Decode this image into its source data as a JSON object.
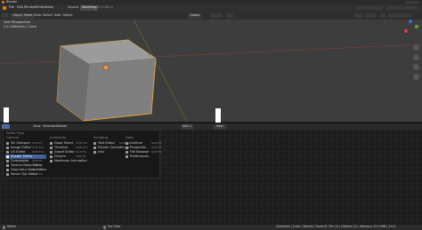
{
  "window": {
    "title": "Blender"
  },
  "menubar": {
    "items": [
      "File",
      "Edit",
      "Render",
      "Window",
      "Help"
    ],
    "tabs": [
      "Layout",
      "Modeling",
      "UV Editing"
    ],
    "active_tab_index": 1
  },
  "viewport": {
    "mode_label": "Object Mode",
    "header_items": [
      "View",
      "Select",
      "Add",
      "Object"
    ],
    "overlay_line1": "User Perspective",
    "overlay_line2": "(1) Collection | Cube",
    "transform_label": "Global"
  },
  "editor": {
    "header_items": [
      "View",
      "Select",
      "Add",
      "Node"
    ],
    "new_label": "New",
    "slot_label": "Slot 1"
  },
  "editor_type_menu": {
    "title": "Editor Type",
    "columns": [
      {
        "heading": "General",
        "items": [
          {
            "label": "3D Viewport",
            "shortcut": "Shift F5"
          },
          {
            "label": "Image Editor",
            "shortcut": "Shift F10"
          },
          {
            "label": "UV Editor",
            "shortcut": "Shift F10"
          },
          {
            "label": "Shader Editor",
            "shortcut": "Shift F3",
            "selected": true
          },
          {
            "label": "Compositor",
            "shortcut": "Shift F3"
          },
          {
            "label": "Texture Node Editor",
            "shortcut": "Shift F3"
          },
          {
            "label": "Geometry Node Editor",
            "shortcut": "Shift F3"
          },
          {
            "label": "Movie Clip Editor",
            "shortcut": "Shift F2"
          }
        ]
      },
      {
        "heading": "Animation",
        "items": [
          {
            "label": "Dope Sheet",
            "shortcut": "Shift F12"
          },
          {
            "label": "Timeline",
            "shortcut": "Shift F12"
          },
          {
            "label": "Graph Editor",
            "shortcut": "Shift F6"
          },
          {
            "label": "Drivers",
            "shortcut": "Shift F6"
          },
          {
            "label": "Nonlinear Animation",
            "shortcut": ""
          }
        ]
      },
      {
        "heading": "Scripting",
        "items": [
          {
            "label": "Text Editor",
            "shortcut": "Shift F11"
          },
          {
            "label": "Python Console",
            "shortcut": "Shift F4"
          },
          {
            "label": "Info",
            "shortcut": ""
          }
        ]
      },
      {
        "heading": "Data",
        "items": [
          {
            "label": "Outliner",
            "shortcut": "Shift F9"
          },
          {
            "label": "Properties",
            "shortcut": "Shift F7"
          },
          {
            "label": "File Browser",
            "shortcut": "Shift F1"
          },
          {
            "label": "Preferences",
            "shortcut": ""
          }
        ]
      }
    ]
  },
  "statusbar": {
    "left": "Select",
    "middle": "Pan View",
    "right": "Collection | Cube | Verts:8 | Faces:6 | Tris:12 | Objects:1/1 | Memory: 24.3 MiB | 3.0.0"
  }
}
